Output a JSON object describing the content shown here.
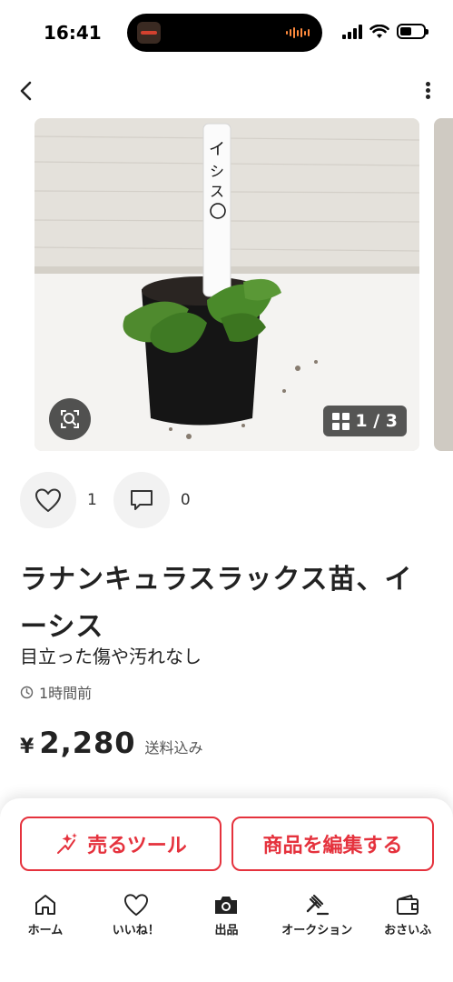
{
  "status_bar": {
    "time": "16:41"
  },
  "photo": {
    "counter": "1 / 3"
  },
  "actions": {
    "likes": "1",
    "comments": "0"
  },
  "item": {
    "title_line1": "ラナンキュラスラックス苗、イ",
    "title_line2": "ーシス",
    "condition": "目立った傷や汚れなし",
    "posted": "1時間前",
    "currency": "¥",
    "price": "2,280",
    "shipping": "送料込み"
  },
  "buttons": {
    "sell_tools": "売るツール",
    "edit_item": "商品を編集する"
  },
  "tabs": [
    "ホーム",
    "いいね！",
    "出品",
    "オークション",
    "おさいふ"
  ],
  "colors": {
    "accent": "#e5323d",
    "text": "#222222"
  },
  "icons": [
    "back-arrow-icon",
    "more-icon",
    "lens-search-icon",
    "grid-icon",
    "heart-icon",
    "comment-icon",
    "clock-icon",
    "sparkle-icon",
    "home-icon",
    "camera-icon",
    "gavel-icon",
    "wallet-icon"
  ]
}
